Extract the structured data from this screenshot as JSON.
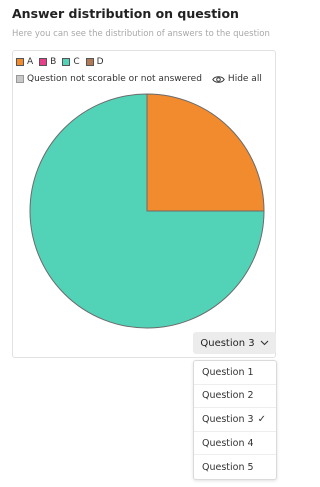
{
  "header": {
    "title": "Answer distribution on question",
    "subtitle": "Here you can see the distribution of answers to the question"
  },
  "legend": {
    "items": [
      {
        "label": "A",
        "color": "#f28a2e"
      },
      {
        "label": "B",
        "color": "#e83e8c"
      },
      {
        "label": "C",
        "color": "#52d3b8"
      },
      {
        "label": "D",
        "color": "#b07a56"
      }
    ],
    "not_scorable": {
      "label": "Question not scorable or not answered",
      "color": "#c8c8c8"
    },
    "hide_all": "Hide all"
  },
  "chart_data": {
    "type": "pie",
    "categories": [
      "A",
      "C"
    ],
    "values": [
      25,
      75
    ],
    "colors": [
      "#f28a2e",
      "#52d3b8"
    ],
    "title": "Answer distribution on question"
  },
  "question_select": {
    "selected": "Question 3",
    "options": [
      "Question 1",
      "Question 2",
      "Question 3",
      "Question 4",
      "Question 5"
    ],
    "check_mark": "✓"
  }
}
